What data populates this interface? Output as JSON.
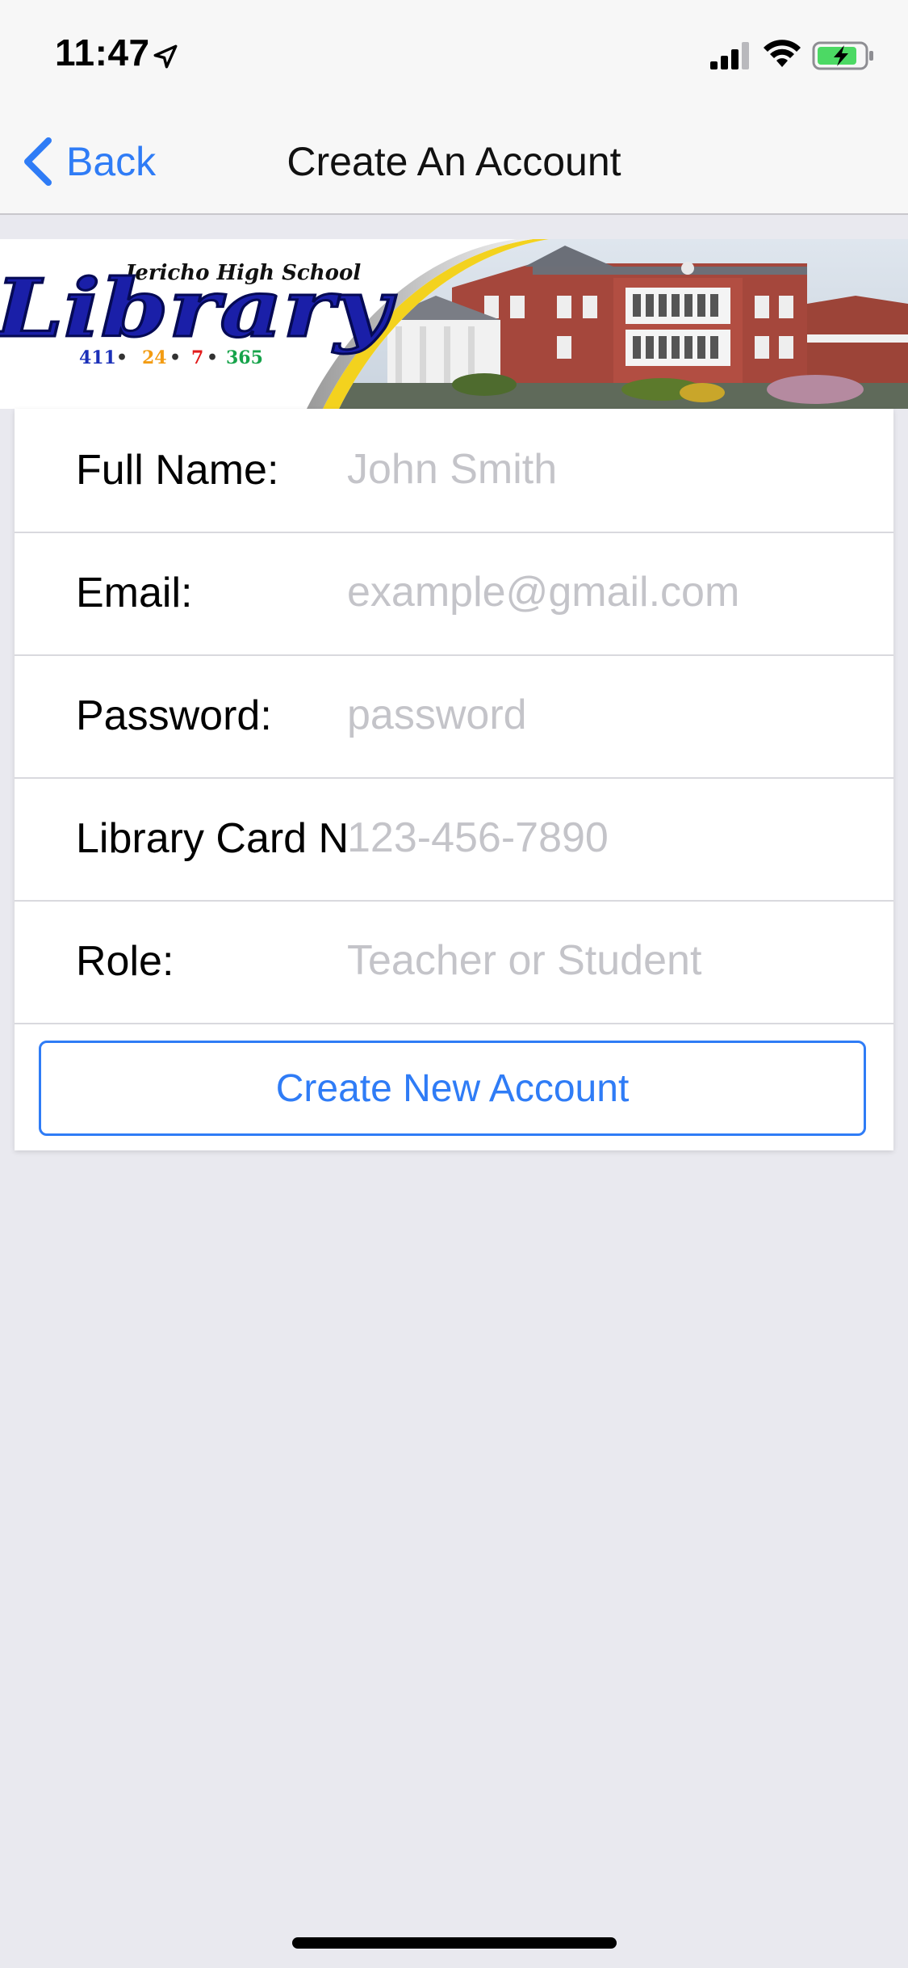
{
  "status_bar": {
    "time": "11:47",
    "icons": [
      "location-arrow-icon",
      "cellular-signal-icon",
      "wifi-icon",
      "battery-charging-icon"
    ]
  },
  "nav": {
    "back_label": "Back",
    "title": "Create An Account"
  },
  "banner": {
    "school_name": "Jericho High School",
    "word": "Library",
    "hours": [
      "411",
      "24",
      "7",
      "365"
    ],
    "hours_colors": [
      "#1a2fb8",
      "#f39c12",
      "#e21b1b",
      "#16a34a"
    ]
  },
  "form": {
    "fields": [
      {
        "label": "Full Name:",
        "placeholder": "John Smith",
        "value": ""
      },
      {
        "label": "Email:",
        "placeholder": "example@gmail.com",
        "value": ""
      },
      {
        "label": "Password:",
        "placeholder": "password",
        "value": ""
      },
      {
        "label": "Library Card Number:",
        "placeholder": "123-456-7890",
        "value": ""
      },
      {
        "label": "Role:",
        "placeholder": "Teacher or Student",
        "value": ""
      }
    ],
    "submit_label": "Create New Account"
  },
  "colors": {
    "accent": "#2f7cf6",
    "background": "#e9e9ef",
    "nav_background": "#f7f7f7",
    "placeholder": "#c4c4c9"
  }
}
